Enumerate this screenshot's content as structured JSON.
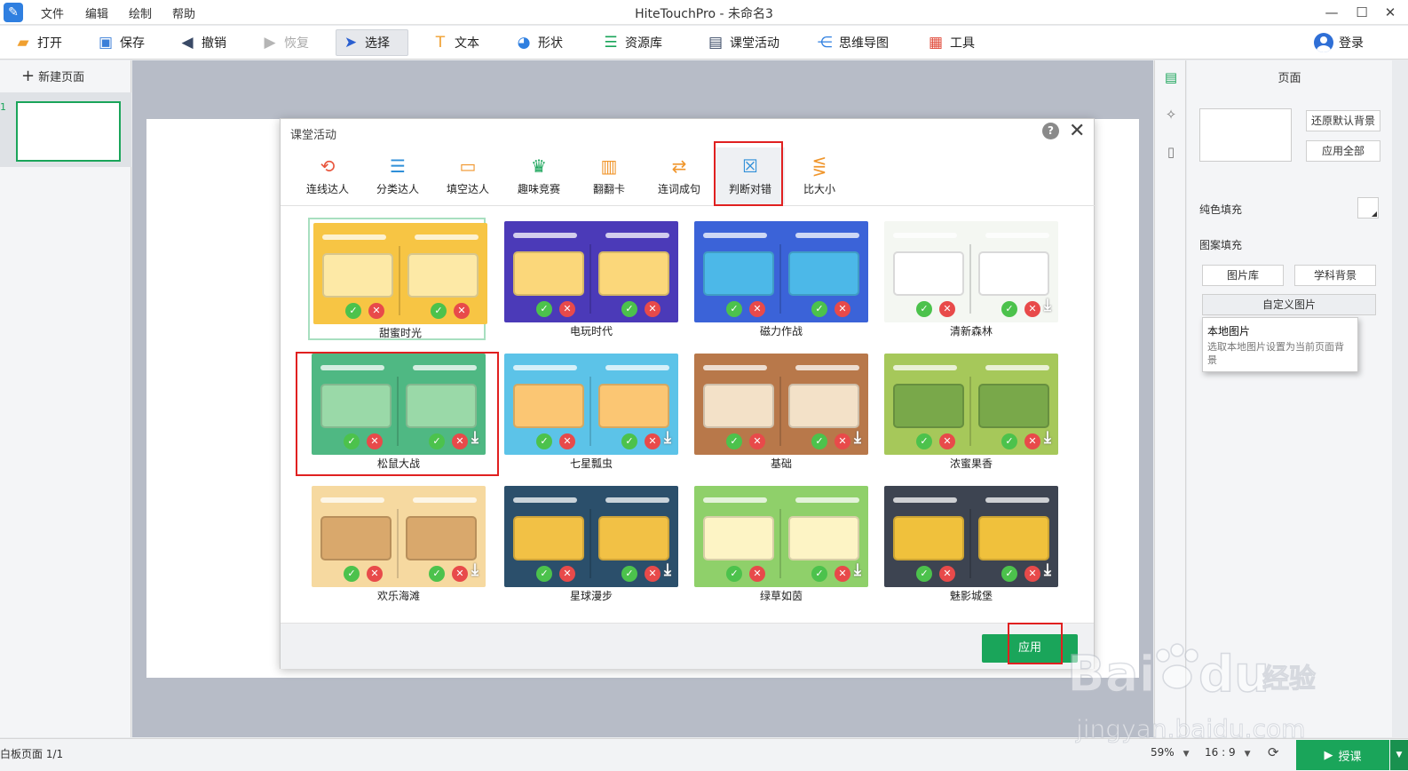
{
  "titlebar": {
    "title": "HiteTouchPro - 未命名3",
    "menu": [
      "文件",
      "编辑",
      "绘制",
      "帮助"
    ]
  },
  "toolbar": {
    "open": "打开",
    "save": "保存",
    "undo": "撤销",
    "redo": "恢复",
    "select": "选择",
    "text": "文本",
    "shape": "形状",
    "resources": "资源库",
    "activity": "课堂活动",
    "mindmap": "思维导图",
    "tools": "工具",
    "login": "登录"
  },
  "left_panel": {
    "new_page": "新建页面",
    "page_number": "1"
  },
  "right_panel": {
    "title": "页面",
    "restore_bg": "还原默认背景",
    "apply_all": "应用全部",
    "solid_fill": "纯色填充",
    "pattern_fill": "图案填充",
    "gallery": "图片库",
    "subject_bg": "学科背景",
    "custom_image": "自定义图片",
    "dropdown": {
      "title": "本地图片",
      "desc": "选取本地图片设置为当前页面背景"
    }
  },
  "modal": {
    "title": "课堂活动",
    "help": "?",
    "tabs": [
      {
        "label": "连线达人",
        "icon": "link-icon",
        "color": "#e8553c"
      },
      {
        "label": "分类达人",
        "icon": "list-icon",
        "color": "#2f8fd8"
      },
      {
        "label": "填空达人",
        "icon": "fill-blank-icon",
        "color": "#f0962c"
      },
      {
        "label": "趣味竞赛",
        "icon": "trophy-icon",
        "color": "#1aa55a"
      },
      {
        "label": "翻翻卡",
        "icon": "flip-card-icon",
        "color": "#f0962c"
      },
      {
        "label": "连词成句",
        "icon": "word-link-icon",
        "color": "#f0962c"
      },
      {
        "label": "判断对错",
        "icon": "true-false-icon",
        "color": "#2f8fd8"
      },
      {
        "label": "比大小",
        "icon": "compare-icon",
        "color": "#f0962c"
      }
    ],
    "themes": [
      {
        "name": "甜蜜时光",
        "bg": "#f7c544",
        "box": "#fde9a6"
      },
      {
        "name": "电玩时代",
        "bg": "#4b3ab8",
        "box": "#fbd77a"
      },
      {
        "name": "磁力作战",
        "bg": "#3b63d8",
        "box": "#4cb8e8"
      },
      {
        "name": "清新森林",
        "bg": "#f4f7f2",
        "box": "#ffffff"
      },
      {
        "name": "松鼠大战",
        "bg": "#4fb883",
        "box": "#9ad9a8"
      },
      {
        "name": "七星瓢虫",
        "bg": "#5cc3e8",
        "box": "#fbc673"
      },
      {
        "name": "基础",
        "bg": "#b8784a",
        "box": "#f3e1c8"
      },
      {
        "name": "浓蜜果香",
        "bg": "#a6c85a",
        "box": "#79a84a"
      },
      {
        "name": "欢乐海滩",
        "bg": "#f6d9a0",
        "box": "#d9a86c"
      },
      {
        "name": "星球漫步",
        "bg": "#2b4f6b",
        "box": "#f2c145"
      },
      {
        "name": "绿草如茵",
        "bg": "#8fd06a",
        "box": "#fdf4c5"
      },
      {
        "name": "魅影城堡",
        "bg": "#3d4451",
        "box": "#f0c13c"
      }
    ],
    "apply": "应用"
  },
  "statusbar": {
    "pages": "白板页面 1/1",
    "zoom": "59%",
    "ratio": "16 : 9",
    "teach": "授课"
  },
  "watermark": {
    "brand": "Bai",
    "brand2": "du",
    "cn": "经验",
    "url": "jingyan.baidu.com"
  }
}
